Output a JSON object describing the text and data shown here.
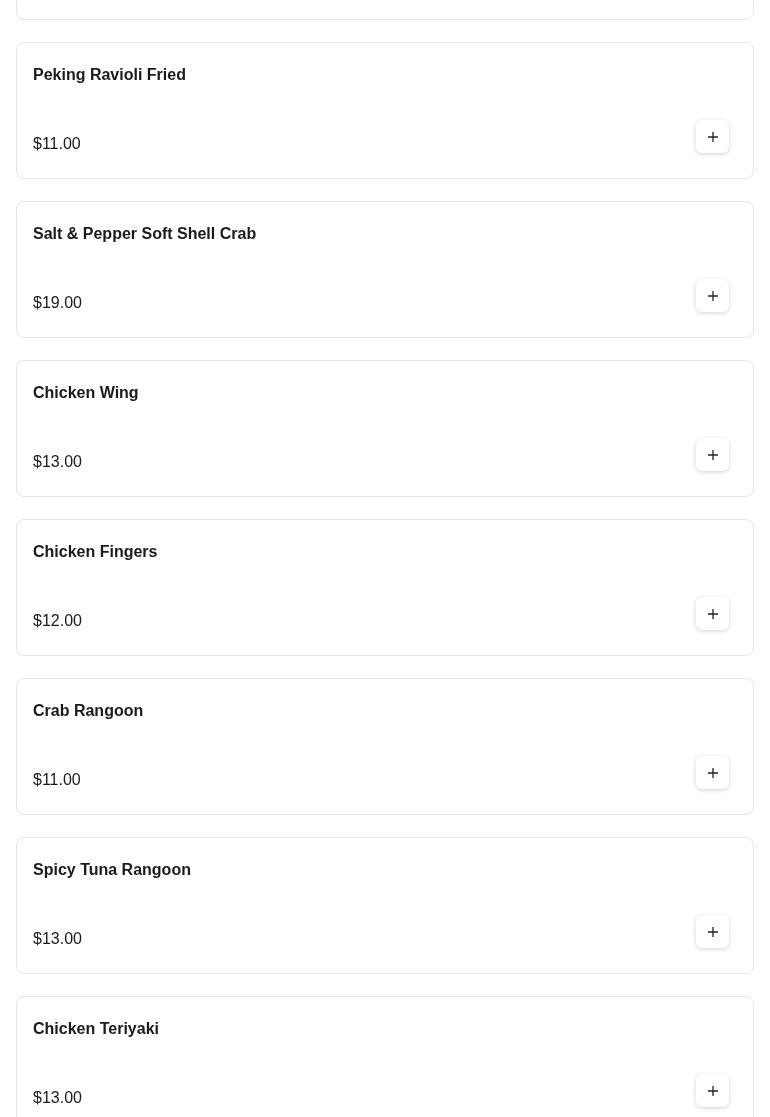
{
  "items": [
    {
      "name": "Peking Ravioli Fried",
      "price": "$11.00"
    },
    {
      "name": "Salt & Pepper Soft Shell Crab",
      "price": "$19.00"
    },
    {
      "name": "Chicken Wing",
      "price": "$13.00"
    },
    {
      "name": "Chicken Fingers",
      "price": "$12.00"
    },
    {
      "name": "Crab Rangoon",
      "price": "$11.00"
    },
    {
      "name": "Spicy Tuna Rangoon",
      "price": "$13.00"
    },
    {
      "name": "Chicken Teriyaki",
      "price": "$13.00"
    }
  ]
}
